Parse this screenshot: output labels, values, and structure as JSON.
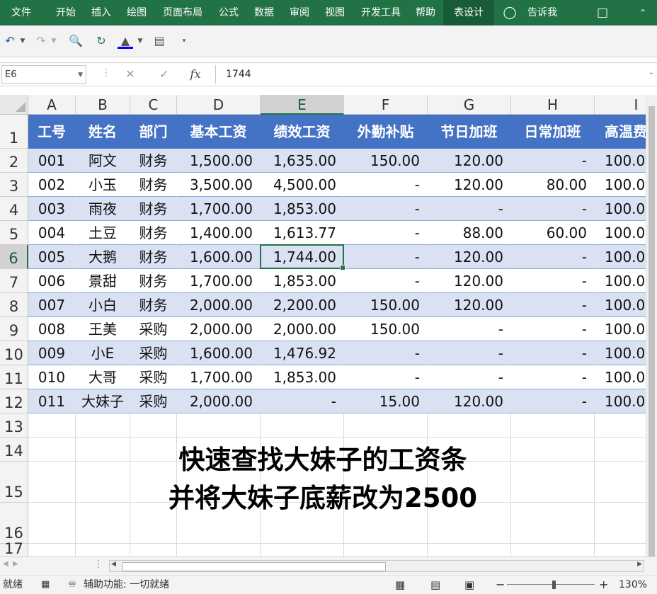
{
  "ribbon": {
    "tabs": [
      "文件",
      "开始",
      "插入",
      "绘图",
      "页面布局",
      "公式",
      "数据",
      "审阅",
      "视图",
      "开发工具",
      "帮助",
      "表设计"
    ],
    "tell_me": "告诉我",
    "active_tab": "表设计"
  },
  "formula_bar": {
    "name_box": "E6",
    "fx": "fx",
    "value": "1744"
  },
  "columns": [
    "A",
    "B",
    "C",
    "D",
    "E",
    "F",
    "G",
    "H",
    "I"
  ],
  "active_cell": "E6",
  "rows": [
    "1",
    "2",
    "3",
    "4",
    "5",
    "6",
    "7",
    "8",
    "9",
    "10",
    "11",
    "12",
    "13",
    "14",
    "15",
    "16",
    "17"
  ],
  "table": {
    "headers": [
      "工号",
      "姓名",
      "部门",
      "基本工资",
      "绩效工资",
      "外勤补贴",
      "节日加班",
      "日常加班",
      "高温费"
    ],
    "data": [
      [
        "001",
        "阿文",
        "财务",
        "1,500.00",
        "1,635.00",
        "150.00",
        "120.00",
        "-",
        "100.0"
      ],
      [
        "002",
        "小玉",
        "财务",
        "3,500.00",
        "4,500.00",
        "-",
        "120.00",
        "80.00",
        "100.0"
      ],
      [
        "003",
        "雨夜",
        "财务",
        "1,700.00",
        "1,853.00",
        "-",
        "-",
        "-",
        "100.0"
      ],
      [
        "004",
        "土豆",
        "财务",
        "1,400.00",
        "1,613.77",
        "-",
        "88.00",
        "60.00",
        "100.0"
      ],
      [
        "005",
        "大鹅",
        "财务",
        "1,600.00",
        "1,744.00",
        "-",
        "120.00",
        "-",
        "100.0"
      ],
      [
        "006",
        "景甜",
        "财务",
        "1,700.00",
        "1,853.00",
        "-",
        "120.00",
        "-",
        "100.0"
      ],
      [
        "007",
        "小白",
        "财务",
        "2,000.00",
        "2,200.00",
        "150.00",
        "120.00",
        "-",
        "100.0"
      ],
      [
        "008",
        "王美",
        "采购",
        "2,000.00",
        "2,000.00",
        "150.00",
        "-",
        "-",
        "100.0"
      ],
      [
        "009",
        "小E",
        "采购",
        "1,600.00",
        "1,476.92",
        "-",
        "-",
        "-",
        "100.0"
      ],
      [
        "010",
        "大哥",
        "采购",
        "1,700.00",
        "1,853.00",
        "-",
        "-",
        "-",
        "100.0"
      ],
      [
        "011",
        "大妹子",
        "采购",
        "2,000.00",
        "-",
        "15.00",
        "120.00",
        "-",
        "100.0"
      ]
    ]
  },
  "overlay": {
    "line1": "快速查找大妹子的工资条",
    "line2": "并将大妹子底薪改为2500"
  },
  "status": {
    "ready": "就绪",
    "accessibility": "辅助功能: 一切就绪",
    "zoom": "130%"
  },
  "colors": {
    "ribbon": "#217346",
    "table_header": "#4472c4",
    "band": "#d9e1f2"
  }
}
